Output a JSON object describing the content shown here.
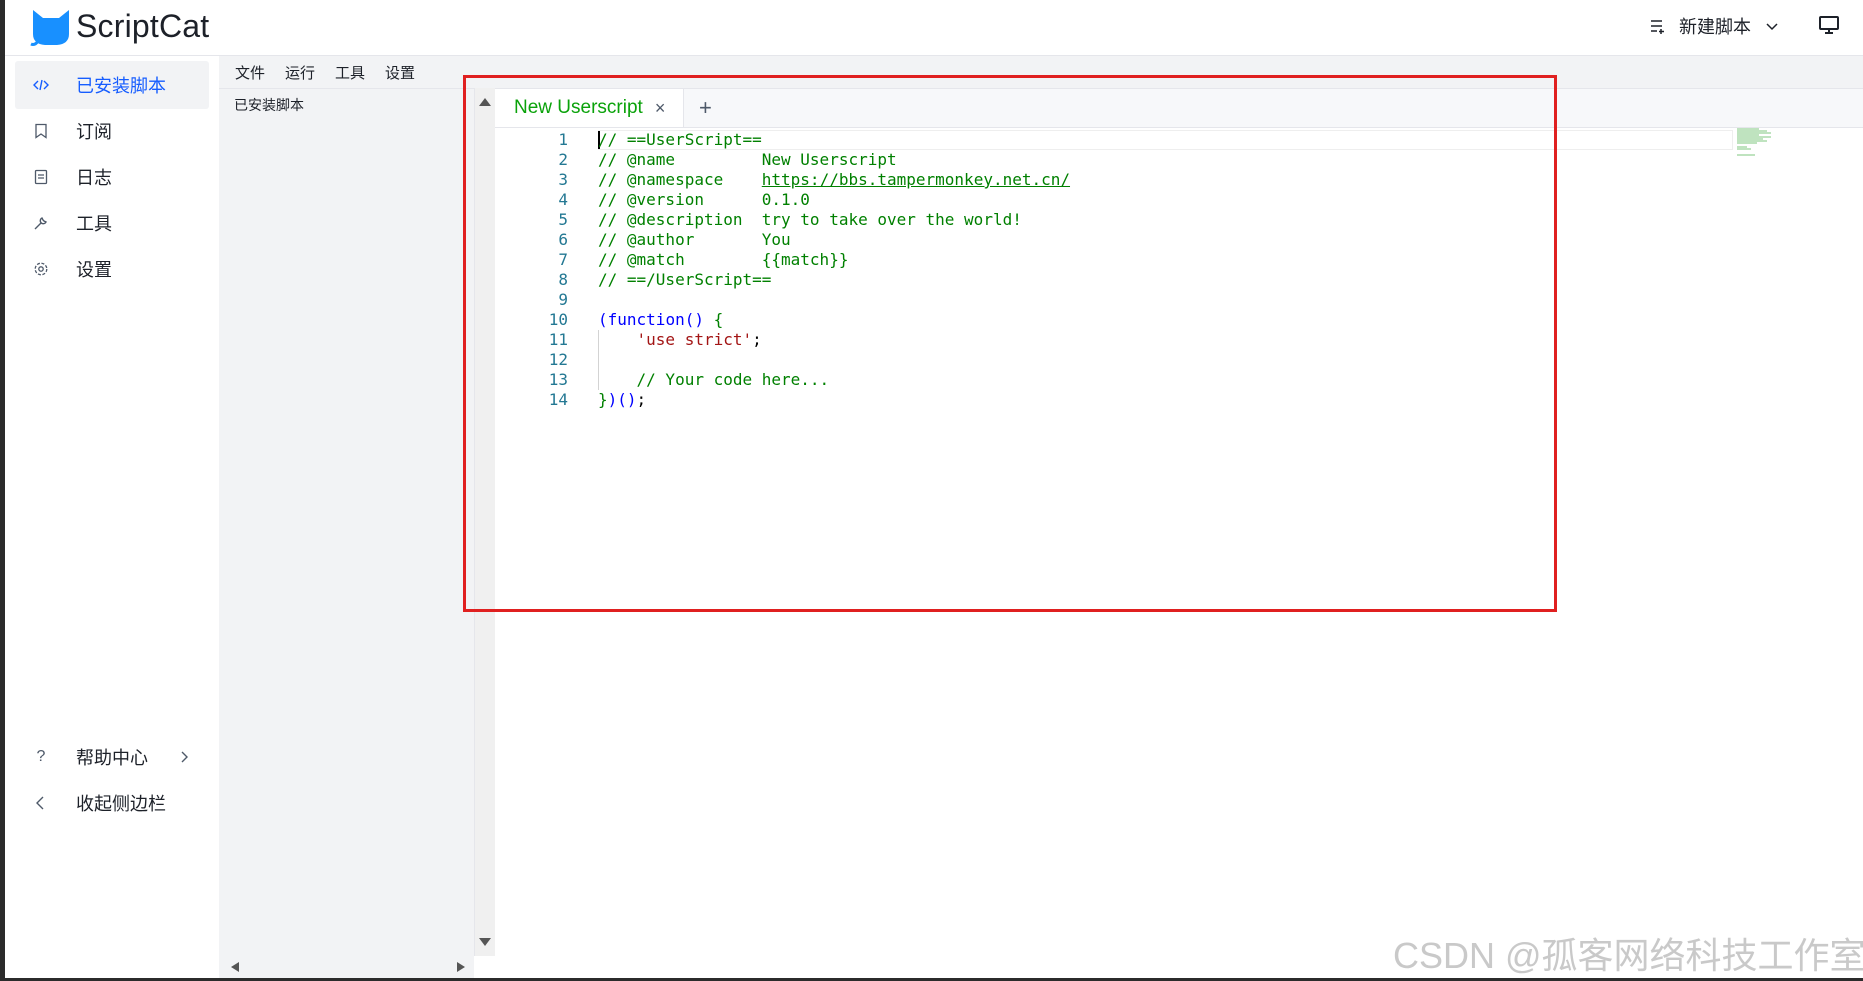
{
  "app": {
    "logo_text": "ScriptCat",
    "new_script_label": "新建脚本"
  },
  "sidebar": {
    "items": [
      {
        "label": "已安装脚本",
        "icon": "code-icon",
        "active": true
      },
      {
        "label": "订阅",
        "icon": "bookmark-icon"
      },
      {
        "label": "日志",
        "icon": "document-icon"
      },
      {
        "label": "工具",
        "icon": "wrench-icon"
      },
      {
        "label": "设置",
        "icon": "gear-icon"
      }
    ],
    "help_label": "帮助中心",
    "collapse_label": "收起侧边栏"
  },
  "menu": {
    "items": [
      "文件",
      "运行",
      "工具",
      "设置"
    ]
  },
  "panel": {
    "title": "已安装脚本"
  },
  "editor": {
    "tab_label": "New Userscript",
    "tab_close": "×",
    "tab_add": "+",
    "lines": [
      {
        "n": "1",
        "parts": [
          {
            "t": "// ==UserScript==",
            "c": "cmt"
          }
        ]
      },
      {
        "n": "2",
        "parts": [
          {
            "t": "// @name         New Userscript",
            "c": "cmt"
          }
        ]
      },
      {
        "n": "3",
        "parts": [
          {
            "t": "// @namespace    ",
            "c": "cmt"
          },
          {
            "t": "https://bbs.tampermonkey.net.cn/",
            "c": "cmt link"
          }
        ]
      },
      {
        "n": "4",
        "parts": [
          {
            "t": "// @version      0.1.0",
            "c": "cmt"
          }
        ]
      },
      {
        "n": "5",
        "parts": [
          {
            "t": "// @description  try to take over the world!",
            "c": "cmt"
          }
        ]
      },
      {
        "n": "6",
        "parts": [
          {
            "t": "// @author       You",
            "c": "cmt"
          }
        ]
      },
      {
        "n": "7",
        "parts": [
          {
            "t": "// @match        {{match}}",
            "c": "cmt"
          }
        ]
      },
      {
        "n": "8",
        "parts": [
          {
            "t": "// ==/UserScript==",
            "c": "cmt"
          }
        ]
      },
      {
        "n": "9",
        "parts": []
      },
      {
        "n": "10",
        "parts": [
          {
            "t": "(",
            "c": "kw"
          },
          {
            "t": "function",
            "c": "kw"
          },
          {
            "t": "() ",
            "c": "kw"
          },
          {
            "t": "{",
            "c": "cmt"
          }
        ]
      },
      {
        "n": "11",
        "parts": [
          {
            "t": "    ",
            "c": "plain"
          },
          {
            "t": "'use strict'",
            "c": "str"
          },
          {
            "t": ";",
            "c": "plain"
          }
        ]
      },
      {
        "n": "12",
        "parts": []
      },
      {
        "n": "13",
        "parts": [
          {
            "t": "    ",
            "c": "plain"
          },
          {
            "t": "// Your code here...",
            "c": "cmt"
          }
        ]
      },
      {
        "n": "14",
        "parts": [
          {
            "t": "}",
            "c": "cmt"
          },
          {
            "t": ")()",
            "c": "kw"
          },
          {
            "t": ";",
            "c": "plain"
          }
        ]
      }
    ]
  },
  "watermark": "CSDN @孤客网络科技工作室",
  "colors": {
    "accent": "#165dff",
    "tab_green": "#0aa20a",
    "comment": "#008000",
    "keyword": "#0000ff",
    "string": "#a31515",
    "highlight_box": "#e02020"
  }
}
